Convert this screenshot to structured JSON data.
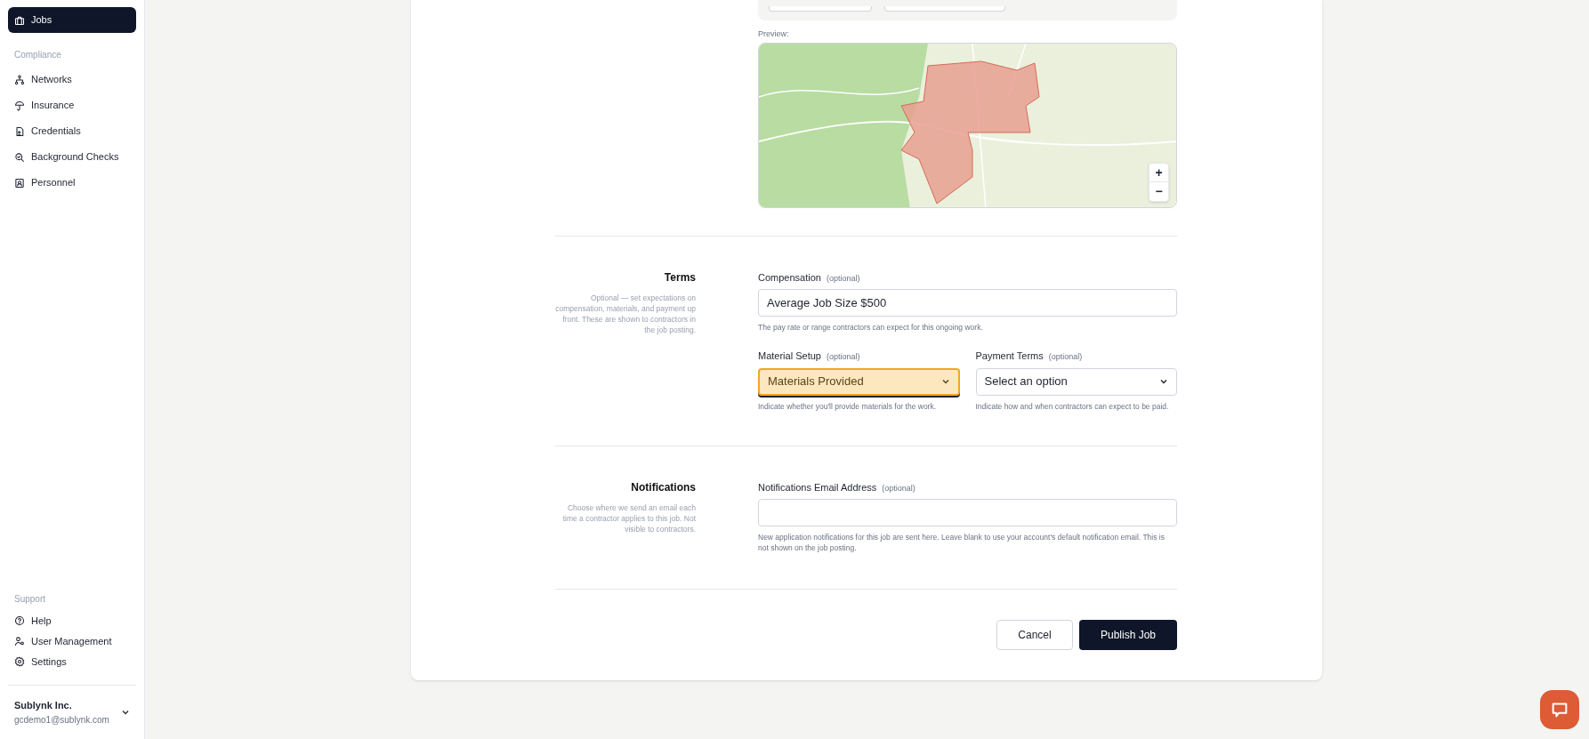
{
  "sidebar": {
    "groups": [
      {
        "items": [
          {
            "label": "Jobs",
            "selected": true
          }
        ]
      },
      {
        "heading": "Compliance",
        "items": [
          {
            "label": "Networks",
            "selected": false
          },
          {
            "label": "Insurance",
            "selected": false
          },
          {
            "label": "Credentials",
            "selected": false
          },
          {
            "label": "Background Checks",
            "selected": false
          },
          {
            "label": "Personnel",
            "selected": false
          }
        ]
      },
      {
        "heading": "Support",
        "items": [
          {
            "label": "Help",
            "selected": false
          },
          {
            "label": "User Management",
            "selected": false
          },
          {
            "label": "Settings",
            "selected": false
          }
        ]
      }
    ],
    "account": {
      "name": "Sublynk Inc.",
      "email": "gcdemo1@sublynk.com"
    }
  },
  "map": {
    "label": "Preview:",
    "zoom_in": "+",
    "zoom_out": "−"
  },
  "sections": [
    {
      "title": "Terms",
      "description": "Optional — set expectations on compensation, materials, and payment up front. These are shown to contractors in the job posting.",
      "rows": [
        {
          "fields": [
            {
              "kind": "text",
              "label": "Compensation",
              "optional": "(optional)",
              "value": "Average Job Size $500",
              "help": "The pay rate or range contractors can expect for this ongoing work.",
              "highlighted": false
            }
          ]
        },
        {
          "fields": [
            {
              "kind": "select",
              "label": "Material Setup",
              "optional": "(optional)",
              "value": "Materials Provided",
              "help": "Indicate whether you'll provide materials for the work.",
              "highlighted": true
            },
            {
              "kind": "select",
              "label": "Payment Terms",
              "optional": "(optional)",
              "value": "Select an option",
              "help": "Indicate how and when contractors can expect to be paid.",
              "highlighted": false
            }
          ]
        }
      ]
    },
    {
      "title": "Notifications",
      "description": "Choose where we send an email each time a contractor applies to this job. Not visible to contractors.",
      "rows": [
        {
          "fields": [
            {
              "kind": "text",
              "label": "Notifications Email Address",
              "optional": "(optional)",
              "help": "New application notifications for this job are sent here. Leave blank to use your account's default notification email. This is not shown on the job posting.",
              "highlighted": false
            }
          ]
        }
      ]
    }
  ],
  "actions": [
    {
      "label": "Cancel",
      "kind": "secondary"
    },
    {
      "label": "Publish Job",
      "kind": "primary"
    }
  ]
}
